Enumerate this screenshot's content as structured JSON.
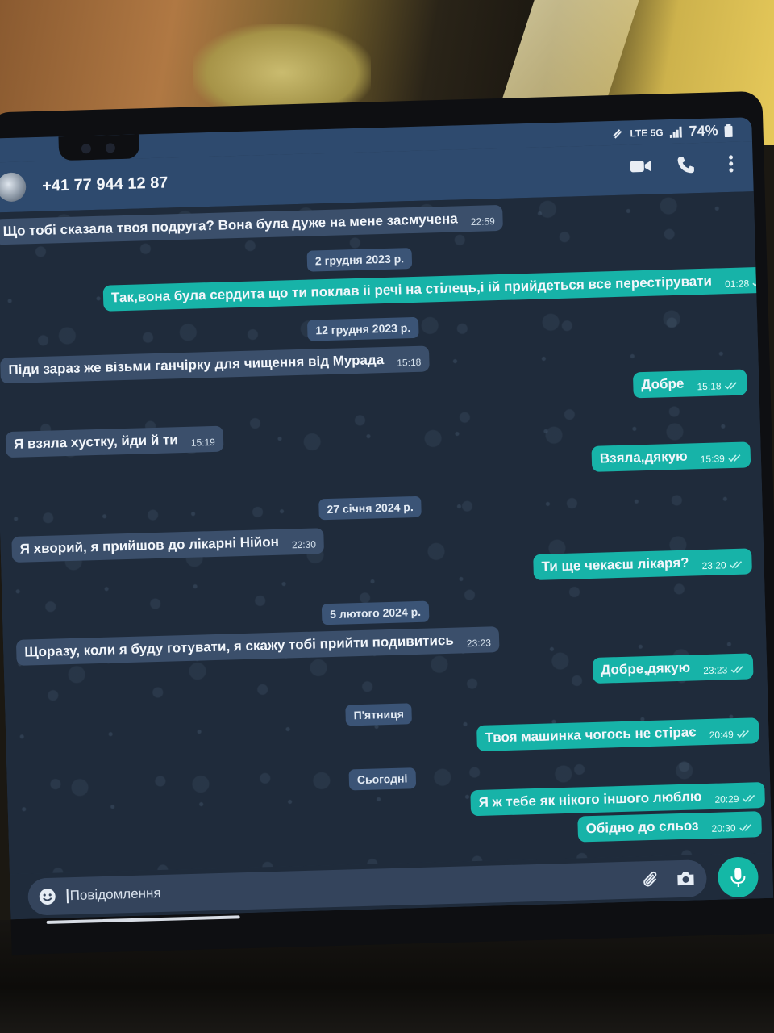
{
  "status_bar": {
    "network_label": "LTE 5G",
    "battery": "74%"
  },
  "header": {
    "contact": "+41 77 944 12 87"
  },
  "messages": [
    {
      "type": "in",
      "text": "Що тобі сказала твоя подруга? Вона була дуже на мене засмучена",
      "time": "22:59"
    },
    {
      "type": "date",
      "text": "2 грудня 2023 р."
    },
    {
      "type": "out",
      "text": "Так,вона була сердита що ти поклав ii речі на стілець,і ій прийдеться все перестірувати",
      "time": "01:28"
    },
    {
      "type": "date",
      "text": "12 грудня 2023 р."
    },
    {
      "type": "in",
      "text": "Піди зараз же візьми ганчірку для чищення від Мурада",
      "time": "15:18"
    },
    {
      "type": "out",
      "text": "Добре",
      "time": "15:18"
    },
    {
      "type": "in",
      "text": "Я взяла хустку, йди й ти",
      "time": "15:19"
    },
    {
      "type": "out",
      "text": "Взяла,дякую",
      "time": "15:39"
    },
    {
      "type": "date",
      "text": "27 січня 2024 р."
    },
    {
      "type": "in",
      "text": "Я хворий, я прийшов до лікарні Нійон",
      "time": "22:30"
    },
    {
      "type": "out",
      "text": "Ти ще чекаєш лікаря?",
      "time": "23:20"
    },
    {
      "type": "date",
      "text": "5 лютого 2024 р."
    },
    {
      "type": "in",
      "text": "Щоразу, коли я буду готувати, я скажу тобі прийти подивитись",
      "time": "23:23"
    },
    {
      "type": "out",
      "text": "Добре,дякую",
      "time": "23:23"
    },
    {
      "type": "date",
      "text": "П'ятниця"
    },
    {
      "type": "out",
      "text": "Твоя машинка чогось не стірає",
      "time": "20:49"
    },
    {
      "type": "date",
      "text": "Сьогодні"
    },
    {
      "type": "out",
      "text": "Я ж тебе як нікого іншого люблю",
      "time": "20:29"
    },
    {
      "type": "out",
      "text": "Обідно до сльоз",
      "time": "20:30"
    }
  ],
  "composer": {
    "placeholder": "Повідомлення"
  },
  "colors": {
    "incoming_bubble": "#3b4f6b",
    "outgoing_bubble": "#17b3a8",
    "header": "#2e4a6e",
    "accent": "#14b8a6"
  },
  "icons": [
    "video-call-icon",
    "phone-icon",
    "more-icon",
    "emoji-icon",
    "attach-icon",
    "camera-icon",
    "mic-icon",
    "double-check-icon"
  ]
}
